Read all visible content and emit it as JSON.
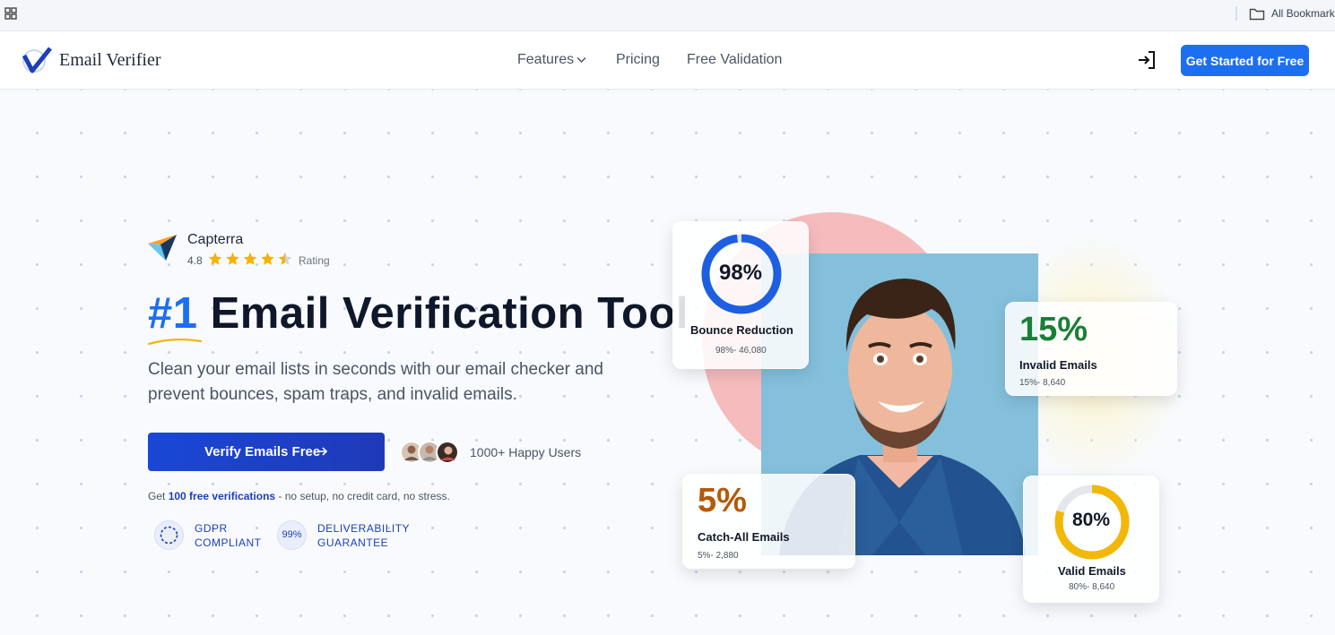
{
  "browser": {
    "bookmarks_label": "All Bookmarks",
    "icons": [
      "apps-grid-icon",
      "folder-icon"
    ]
  },
  "header": {
    "brand": "Email Verifier",
    "nav": [
      "Features",
      "Pricing",
      "Free Validation"
    ],
    "cta": "Get Started for Free",
    "icons": [
      "logo-check-icon",
      "chevron-down-icon",
      "login-icon"
    ]
  },
  "hero": {
    "capterra": {
      "name": "Capterra",
      "score": "4.8",
      "rating_label": "Rating",
      "stars": 4.5
    },
    "headline_accent": "#1",
    "headline_rest": " Email Verification Tool",
    "subtext": "Clean your email lists in seconds with our email checker and prevent bounces, spam traps, and invalid emails.",
    "verify_button": "Verify Emails Free",
    "happy_users": "1000+ Happy Users",
    "free_note_prefix": "Get ",
    "free_note_strong": "100 free verifications",
    "free_note_suffix": " - no setup, no credit card, no stress.",
    "badges": {
      "gdpr_line1": "GDPR",
      "gdpr_line2": "COMPLIANT",
      "pct": "99%",
      "deliv_line1": "DELIVERABILITY",
      "deliv_line2": "GUARANTEE"
    }
  },
  "stats": {
    "bounce": {
      "pct": "98%",
      "title": "Bounce Reduction",
      "sub": "98%- 46,080",
      "fill": 0.98
    },
    "invalid": {
      "pct": "15%",
      "title": "Invalid Emails",
      "sub": "15%- 8,640"
    },
    "catch_all": {
      "pct": "5%",
      "title": "Catch-All Emails",
      "sub": "5%- 2,880"
    },
    "valid": {
      "pct": "80%",
      "title": "Valid Emails",
      "sub": "80%- 8,640",
      "fill": 0.8
    }
  },
  "colors": {
    "primary": "#1d6ff2",
    "button_dark": "#1a47d6",
    "green": "#1a7f37",
    "amber": "#b45a09",
    "ring_blue": "#1d5fe0",
    "ring_yellow": "#f3b707"
  }
}
